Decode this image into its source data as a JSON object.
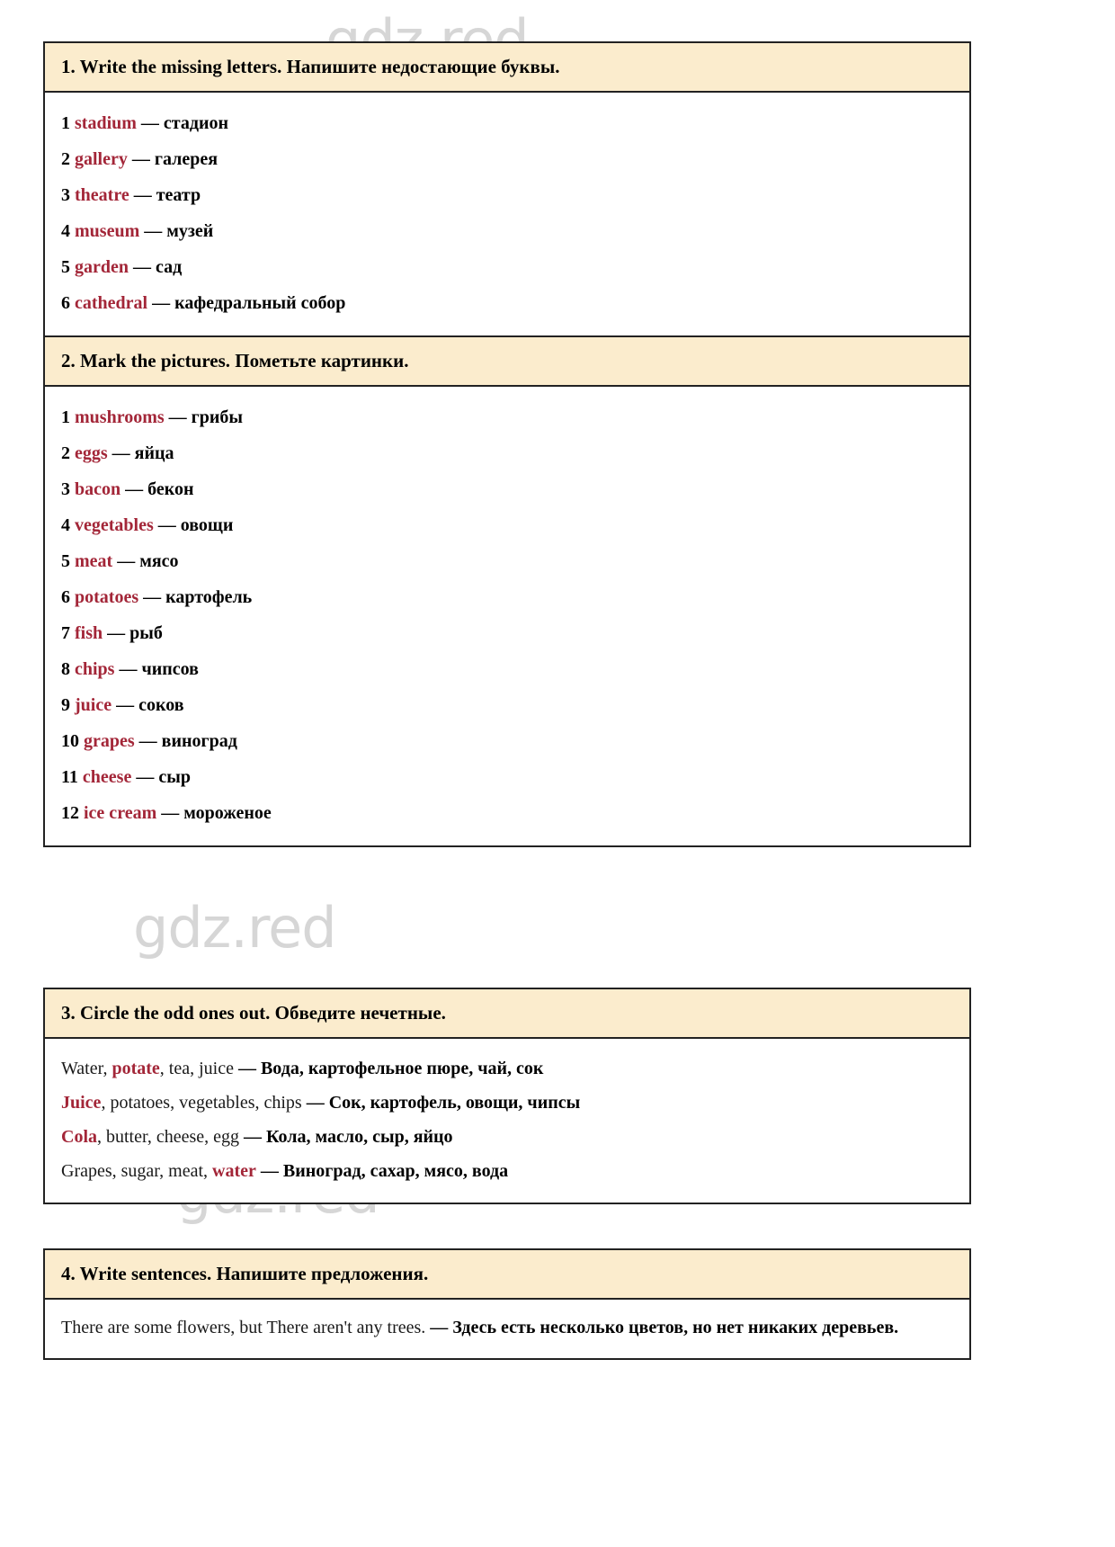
{
  "watermarks": {
    "text": "gdz.red"
  },
  "exercises": [
    {
      "id": "ex1",
      "header": "1. Write the missing letters. Напишите недостающие буквы.",
      "items": [
        {
          "num": "1",
          "en": "stadium",
          "dash": "—",
          "ru": "стадион"
        },
        {
          "num": "2",
          "en": "gallery",
          "dash": "—",
          "ru": "галерея"
        },
        {
          "num": "3",
          "en": "theatre",
          "dash": "—",
          "ru": "театр"
        },
        {
          "num": "4",
          "en": "museum",
          "dash": "—",
          "ru": "музей"
        },
        {
          "num": "5",
          "en": "garden",
          "dash": "—",
          "ru": "сад"
        },
        {
          "num": "6",
          "en": "cathedral",
          "dash": "—",
          "ru": "кафедральный собор"
        }
      ]
    },
    {
      "id": "ex2",
      "header": "2. Mark the pictures. Пометьте картинки.",
      "items": [
        {
          "num": "1",
          "en": "mushrooms",
          "dash": "—",
          "ru": "грибы"
        },
        {
          "num": "2",
          "en": "eggs",
          "dash": "—",
          "ru": "яйца"
        },
        {
          "num": "3",
          "en": "bacon",
          "dash": "—",
          "ru": "бекон"
        },
        {
          "num": "4",
          "en": "vegetables",
          "dash": "—",
          "ru": "овощи"
        },
        {
          "num": "5",
          "en": "meat",
          "dash": "—",
          "ru": "мясо"
        },
        {
          "num": "6",
          "en": "potatoes",
          "dash": "—",
          "ru": "картофель"
        },
        {
          "num": "7",
          "en": "fish",
          "dash": "—",
          "ru": "рыб"
        },
        {
          "num": "8",
          "en": "chips",
          "dash": "—",
          "ru": "чипсов"
        },
        {
          "num": "9",
          "en": "juice",
          "dash": "—",
          "ru": "соков"
        },
        {
          "num": "10",
          "en": "grapes",
          "dash": "—",
          "ru": "виноград"
        },
        {
          "num": "11",
          "en": "cheese",
          "dash": "—",
          "ru": "сыр"
        },
        {
          "num": "12",
          "en": "ice cream",
          "dash": "—",
          "ru": "мороженое"
        }
      ]
    },
    {
      "id": "ex3",
      "header": "3. Circle the odd ones out. Обведите нечетные.",
      "rows": [
        {
          "pre": "Water, ",
          "hl": "potate",
          "post": ", tea, juice ",
          "dash": "— ",
          "ru": "Вода, картофельное пюре, чай, сок",
          "hl_first": false
        },
        {
          "pre": "",
          "hl": "Juice",
          "post": ", potatoes, vegetables, chips ",
          "dash": "— ",
          "ru": "Сок, картофель, овощи, чипсы",
          "hl_first": true
        },
        {
          "pre": "",
          "hl": "Cola",
          "post": ", butter, cheese, egg ",
          "dash": "— ",
          "ru": "Кола, масло, сыр, яйцо",
          "hl_first": true
        },
        {
          "pre": "Grapes, sugar, meat, ",
          "hl": "water",
          "post": " ",
          "dash": "— ",
          "ru": "Виноград, сахар, мясо, вода",
          "hl_first": false
        }
      ]
    },
    {
      "id": "ex4",
      "header": "4. Write sentences. Напишите предложения.",
      "sentence": {
        "en": "There are some flowers, but There aren't any trees. ",
        "dash": "— ",
        "ru": "Здесь есть несколько цветов, но нет никаких деревьев."
      }
    }
  ],
  "colors": {
    "header_bg": "#fbeccd",
    "border": "#222222",
    "accent_red": "#a32638",
    "text": "#000000",
    "watermark": "#c9c9c9"
  }
}
